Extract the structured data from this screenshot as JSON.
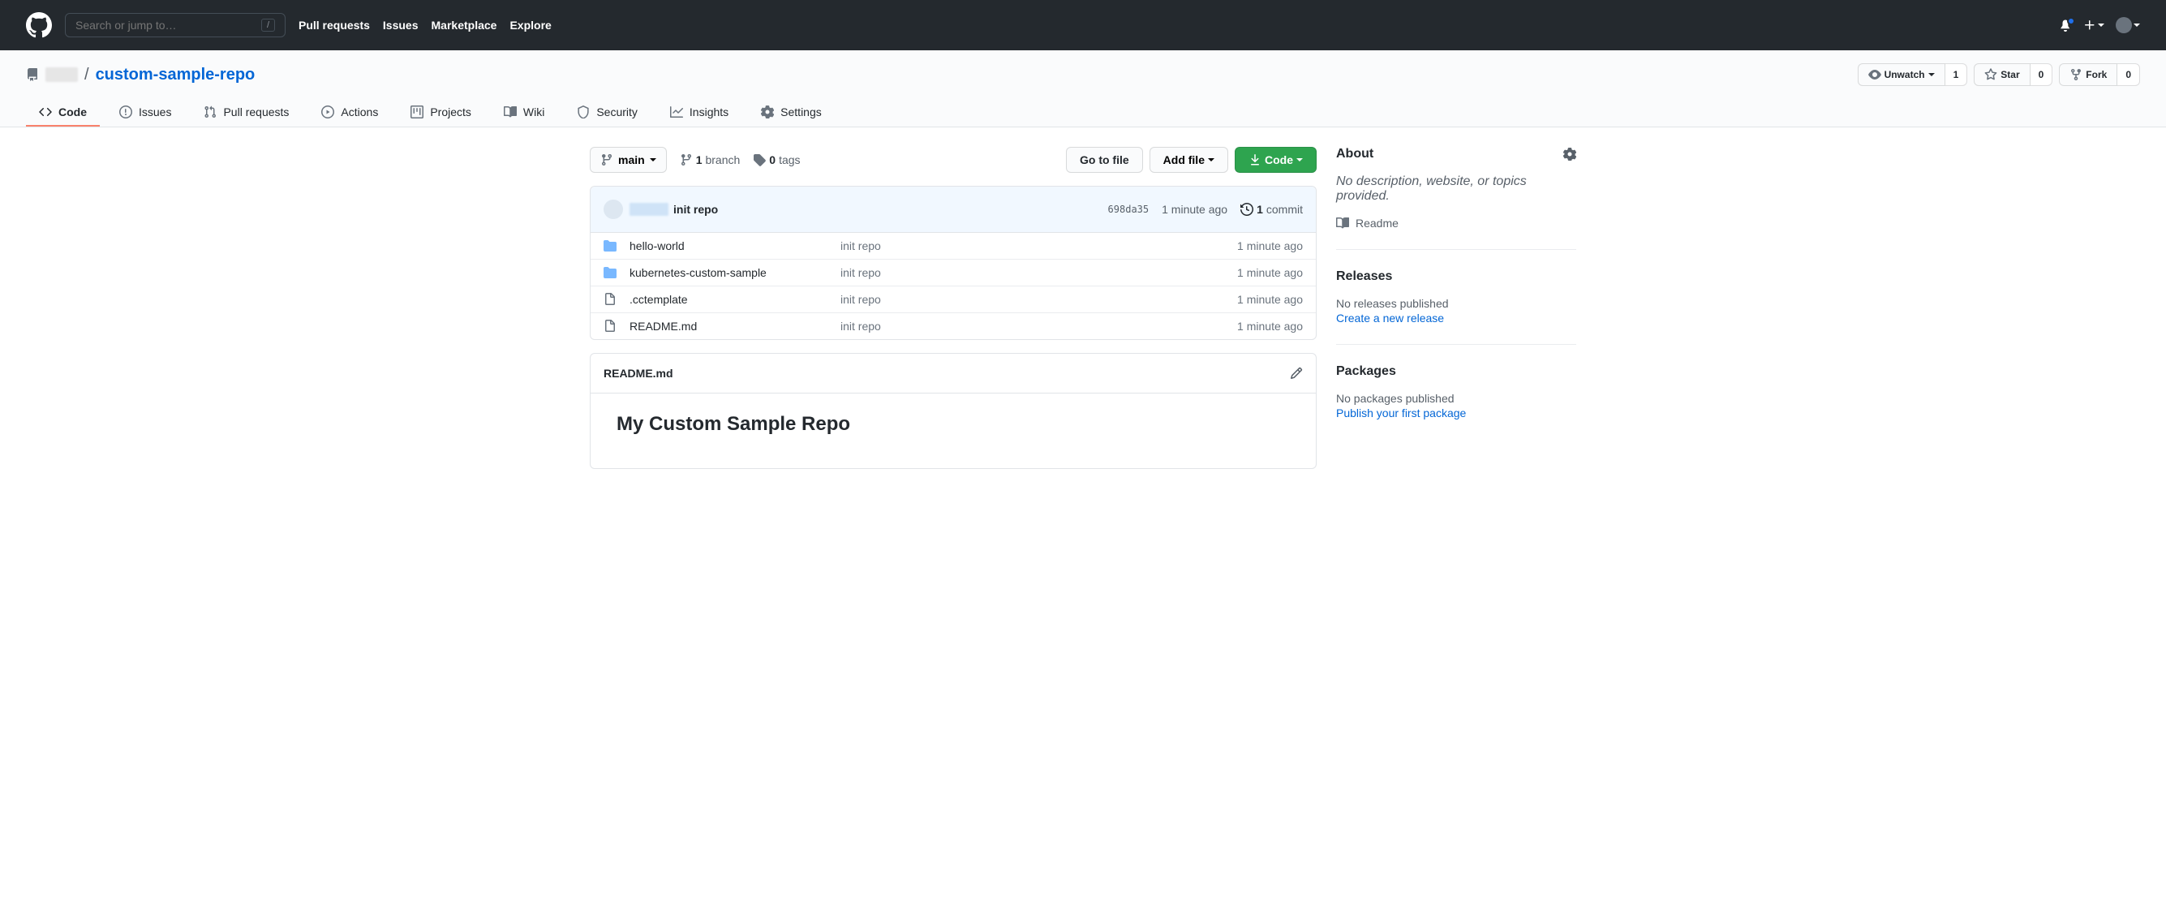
{
  "header": {
    "search_placeholder": "Search or jump to…",
    "slash": "/",
    "nav": [
      "Pull requests",
      "Issues",
      "Marketplace",
      "Explore"
    ]
  },
  "repo": {
    "owner_hidden": true,
    "name": "custom-sample-repo",
    "watch_label": "Unwatch",
    "watch_count": "1",
    "star_label": "Star",
    "star_count": "0",
    "fork_label": "Fork",
    "fork_count": "0"
  },
  "tabs": [
    {
      "label": "Code",
      "active": true
    },
    {
      "label": "Issues"
    },
    {
      "label": "Pull requests"
    },
    {
      "label": "Actions"
    },
    {
      "label": "Projects"
    },
    {
      "label": "Wiki"
    },
    {
      "label": "Security"
    },
    {
      "label": "Insights"
    },
    {
      "label": "Settings"
    }
  ],
  "file_nav": {
    "branch": "main",
    "branch_count": "1",
    "branch_label": "branch",
    "tag_count": "0",
    "tag_label": "tags",
    "go_to_file": "Go to file",
    "add_file": "Add file",
    "code": "Code"
  },
  "commit_bar": {
    "message": "init repo",
    "sha": "698da35",
    "time": "1 minute ago",
    "commit_count": "1",
    "commit_label": "commit"
  },
  "files": [
    {
      "type": "dir",
      "name": "hello-world",
      "msg": "init repo",
      "time": "1 minute ago"
    },
    {
      "type": "dir",
      "name": "kubernetes-custom-sample",
      "msg": "init repo",
      "time": "1 minute ago"
    },
    {
      "type": "file",
      "name": ".cctemplate",
      "msg": "init repo",
      "time": "1 minute ago"
    },
    {
      "type": "file",
      "name": "README.md",
      "msg": "init repo",
      "time": "1 minute ago"
    }
  ],
  "readme": {
    "filename": "README.md",
    "heading": "My Custom Sample Repo"
  },
  "sidebar": {
    "about_title": "About",
    "about_desc": "No description, website, or topics provided.",
    "readme_link": "Readme",
    "releases_title": "Releases",
    "releases_none": "No releases published",
    "releases_create": "Create a new release",
    "packages_title": "Packages",
    "packages_none": "No packages published",
    "packages_publish": "Publish your first package"
  }
}
